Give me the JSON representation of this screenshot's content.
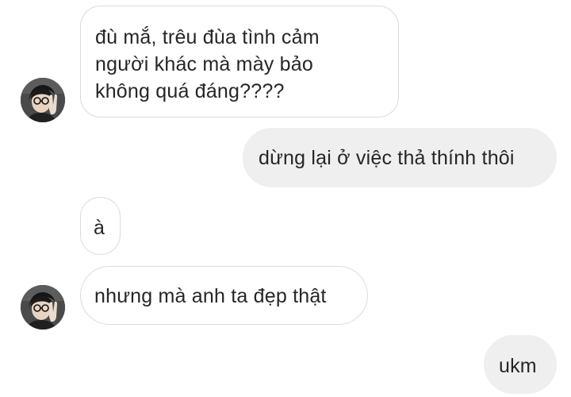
{
  "conversation": {
    "messages": [
      {
        "direction": "received",
        "lines": [
          "đù mắ, trêu đùa tình cảm",
          "người khác mà mày bảo",
          "không quá đáng????"
        ]
      },
      {
        "direction": "sent",
        "lines": [
          "dừng lại ở việc thả thính thôi"
        ]
      },
      {
        "direction": "received",
        "lines": [
          "à"
        ]
      },
      {
        "direction": "received",
        "lines": [
          "nhưng mà anh ta đẹp thật"
        ]
      },
      {
        "direction": "sent",
        "lines": [
          "ukm"
        ]
      }
    ],
    "avatar_icon": "contact-avatar-photo"
  },
  "colors": {
    "background": "#ffffff",
    "received_bubble": "#ffffff",
    "received_border": "#dbdbdb",
    "sent_bubble": "#efefef",
    "text": "#262626"
  }
}
